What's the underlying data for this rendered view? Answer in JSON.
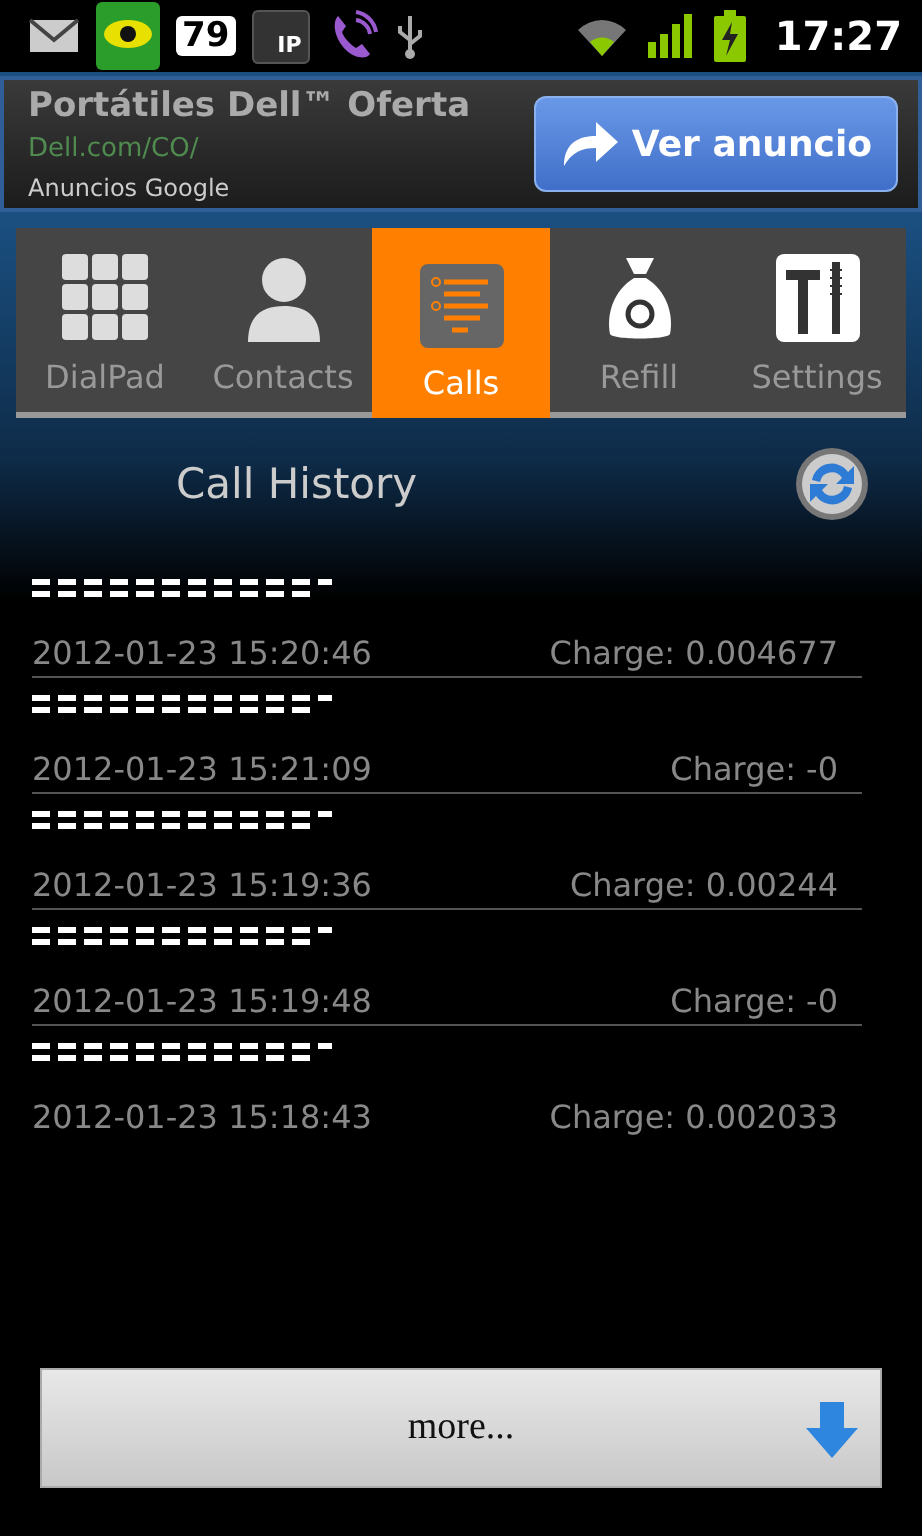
{
  "status_bar": {
    "battery_badge": "79",
    "ip_badge": "IP",
    "time": "17:27"
  },
  "ad": {
    "title": "Portátiles Dell™ Oferta",
    "url": "Dell.com/CO/",
    "source": "Anuncios Google",
    "button": "Ver anuncio"
  },
  "tabs": [
    {
      "label": "DialPad",
      "kind": "dialpad",
      "selected": false
    },
    {
      "label": "Contacts",
      "kind": "contacts",
      "selected": false
    },
    {
      "label": "Calls",
      "kind": "calls",
      "selected": true
    },
    {
      "label": "Refill",
      "kind": "refill",
      "selected": false
    },
    {
      "label": "Settings",
      "kind": "settings",
      "selected": false
    }
  ],
  "header": {
    "title": "Call History"
  },
  "calls": [
    {
      "time": "2012-01-23 15:20:46",
      "charge": "Charge: 0.004677"
    },
    {
      "time": "2012-01-23 15:21:09",
      "charge": "Charge: -0"
    },
    {
      "time": "2012-01-23 15:19:36",
      "charge": "Charge: 0.00244"
    },
    {
      "time": "2012-01-23 15:19:48",
      "charge": "Charge: -0"
    },
    {
      "time": "2012-01-23 15:18:43",
      "charge": "Charge: 0.002033"
    }
  ],
  "more_button": "more..."
}
